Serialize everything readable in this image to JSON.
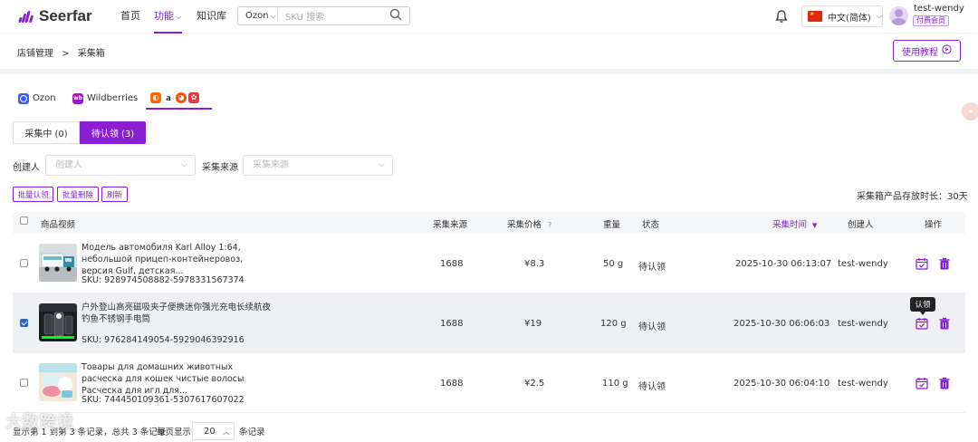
{
  "brand": {
    "name": "Seerfar"
  },
  "nav": {
    "home": "首页",
    "features": "功能",
    "knowledge": "知识库"
  },
  "search": {
    "platform": "Ozon",
    "placeholder": "SKU 搜索"
  },
  "language": "中文(简体)",
  "user": {
    "name": "test-wendy",
    "badge": "付费会员"
  },
  "breadcrumb": {
    "parent": "店铺管理",
    "separator": ">",
    "current": "采集箱"
  },
  "tutorial_label": "使用教程",
  "platform_tabs": {
    "ozon": "Ozon",
    "wildberries": "Wildberries"
  },
  "status_tabs": {
    "collecting": "采集中 (0)",
    "pending": "待认领 (3)"
  },
  "filters": {
    "creator_label": "创建人",
    "creator_placeholder": "创建人",
    "source_label": "采集来源",
    "source_placeholder": "采集来源"
  },
  "actions": {
    "batch_claim": "批量认领",
    "batch_delete": "批量删除",
    "refresh": "刷新"
  },
  "storage_note": "采集箱产品存放时长：30天",
  "table": {
    "headers": {
      "product": "商品视频",
      "source": "采集来源",
      "price": "采集价格",
      "weight": "重量",
      "status": "状态",
      "time": "采集时间",
      "creator": "创建人",
      "ops": "操作"
    },
    "rows": [
      {
        "title": "Модель автомобиля Karl Alloy 1:64, небольшой прицеп-контейнеровоз, версия Gulf, детская...",
        "sku": "SKU: 928974508882-5978331567374",
        "source": "1688",
        "price": "¥8.3",
        "weight": "50 g",
        "status": "待认领",
        "time": "2025-10-30 06:13:07",
        "creator": "test-wendy",
        "checked": false
      },
      {
        "title": "户外登山高亮磁吸夹子便携迷你强光充电长续航夜钓鱼不锈钢手电筒",
        "sku": "SKU: 976284149054-5929046392916",
        "source": "1688",
        "price": "¥19",
        "weight": "120 g",
        "status": "待认领",
        "time": "2025-10-30 06:06:03",
        "creator": "test-wendy",
        "checked": true
      },
      {
        "title": "Товары для домашних животных расческа для кошек чистые волосы Расческа для игл для...",
        "sku": "SKU: 744450109361-5307617607022",
        "source": "1688",
        "price": "¥2.5",
        "weight": "110 g",
        "status": "待认领",
        "time": "2025-10-30 06:04:10",
        "creator": "test-wendy",
        "checked": false
      }
    ]
  },
  "tooltip": "认领",
  "footer": {
    "range": "显示第 1 到第 3 条记录，总共 3 条记录",
    "per_page_label": "每页显示",
    "page_size": "20",
    "unit": "条记录"
  },
  "watermark": "大数跨境",
  "colors": {
    "accent": "#8a1fd1",
    "checkbox": "#2f65c7",
    "delete": "#8a1fd1"
  }
}
